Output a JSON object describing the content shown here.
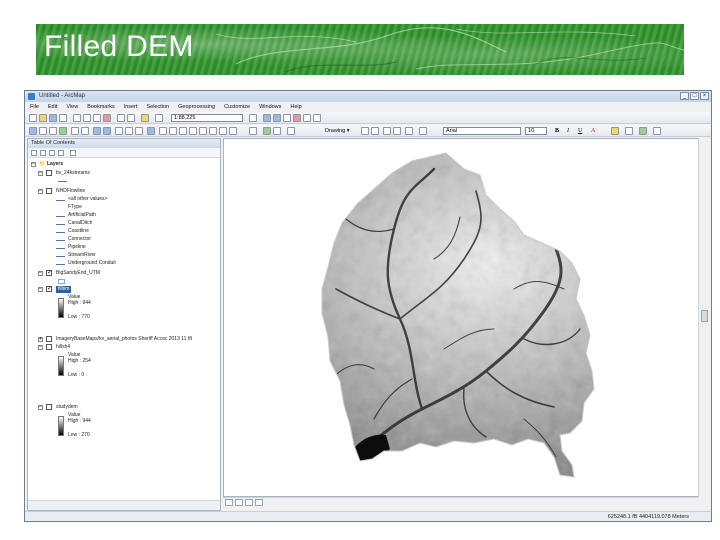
{
  "slide": {
    "title": "Filled DEM",
    "banner_color": "#3c9a38"
  },
  "window": {
    "title": "Untitled - ArcMap",
    "controls": {
      "minimize": "_",
      "maximize": "□",
      "close": "×"
    }
  },
  "menus": [
    "File",
    "Edit",
    "View",
    "Bookmarks",
    "Insert",
    "Selection",
    "Geoprocessing",
    "Customize",
    "Windows",
    "Help"
  ],
  "toolbar": {
    "scale": "1:88,225",
    "drawing_label": "Drawing ▾",
    "font_name": "Arial",
    "font_size": "10",
    "bold": "B",
    "italic": "I",
    "underline": "U",
    "font_color": "A"
  },
  "toc": {
    "title": "Table Of Contents",
    "root": "Layers",
    "layers": [
      {
        "name": "bv_24kstreams",
        "checked": false
      },
      {
        "name": "NHDFlowline",
        "checked": false,
        "field": "FType",
        "classes": [
          "<all other values>",
          "FType",
          "ArtificialPath",
          "CanalDitch",
          "Coastline",
          "Connector",
          "Pipeline",
          "StreamRiver",
          "Underground Conduit"
        ]
      },
      {
        "name": "BigSandyEnd_UTM",
        "checked": true
      },
      {
        "name": "fillsm",
        "checked": true,
        "selected": true,
        "value_label": "Value",
        "high": "High : 944",
        "low": "Low : 770"
      },
      {
        "name": "ImageryBaseMaps/kv_aerial_photos Sheriff Accoc 2013 11 Ift",
        "checked": false
      },
      {
        "name": "hillsh4",
        "checked": false,
        "value_label": "Value",
        "high": "High : 254",
        "low": "Low : 0"
      },
      {
        "name": "studydem",
        "checked": false,
        "value_label": "Value",
        "high": "High : 944",
        "low": "Low : 270"
      }
    ]
  },
  "status": {
    "coordinates": "625248.1 fB 4404119.078 Meters"
  }
}
